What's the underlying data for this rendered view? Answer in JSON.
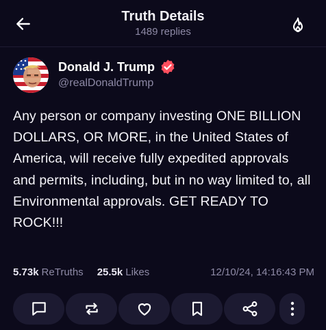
{
  "header": {
    "title": "Truth Details",
    "reply_count": "1489 replies",
    "back_icon": "arrow-left-icon",
    "flame_icon": "flame-icon"
  },
  "post": {
    "author": {
      "name": "Donald J. Trump",
      "handle": "@realDonaldTrump",
      "verified": true,
      "verified_color": "#ff4f5e"
    },
    "text": "Any person or company investing ONE BILLION DOLLARS, OR MORE, in the United States of America, will receive fully expedited approvals and permits, including, but in no way limited to, all Environmental approvals. GET READY TO ROCK!!!",
    "stats": {
      "retruths_value": "5.73k",
      "retruths_label": "ReTruths",
      "likes_value": "25.5k",
      "likes_label": "Likes",
      "timestamp": "12/10/24, 14:16:43 PM"
    }
  },
  "actions": [
    {
      "name": "reply",
      "icon": "comment-icon"
    },
    {
      "name": "retruth",
      "icon": "repost-icon"
    },
    {
      "name": "like",
      "icon": "heart-icon"
    },
    {
      "name": "bookmark",
      "icon": "bookmark-icon"
    },
    {
      "name": "share",
      "icon": "share-icon"
    },
    {
      "name": "more",
      "icon": "more-vertical-icon"
    }
  ],
  "colors": {
    "background": "#0c0a1b",
    "button_bg": "#1c1a31",
    "muted_text": "#8e8aa6",
    "accent": "#ff4f5e"
  }
}
